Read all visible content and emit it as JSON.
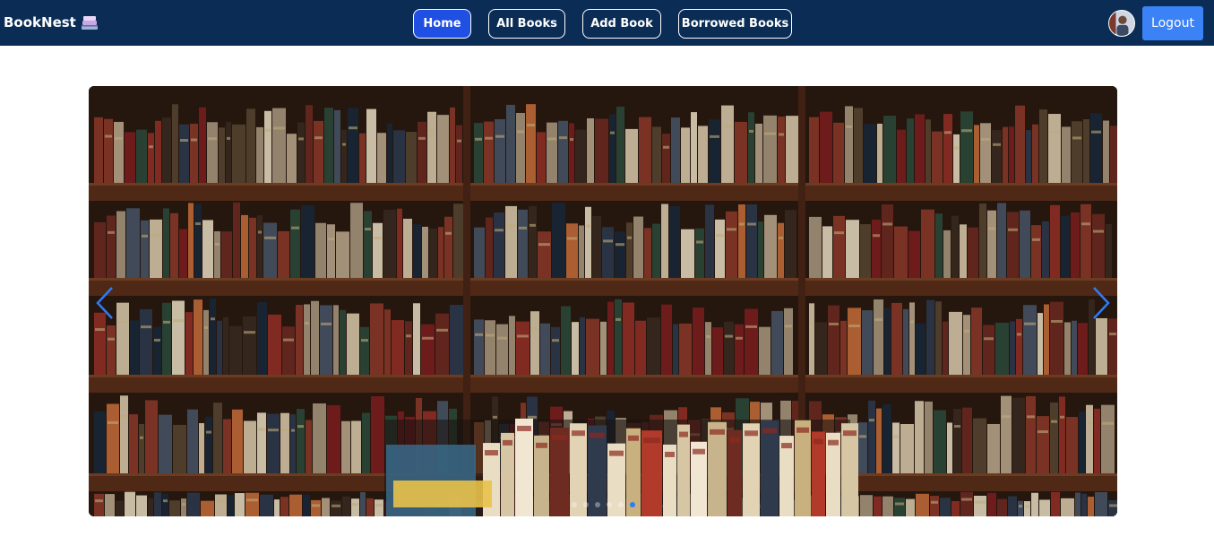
{
  "brand": {
    "name": "BookNest",
    "logo_icon": "book-stack-icon"
  },
  "nav": {
    "items": [
      {
        "label": "Home",
        "active": true
      },
      {
        "label": "All Books",
        "active": false
      },
      {
        "label": "Add Book",
        "active": false
      },
      {
        "label": "Borrowed Books",
        "active": false
      }
    ]
  },
  "user": {
    "avatar_icon": "user-avatar-icon",
    "logout_label": "Logout"
  },
  "carousel": {
    "prev_icon": "chevron-left-icon",
    "next_icon": "chevron-right-icon",
    "slide_count": 6,
    "active_index": 5
  },
  "colors": {
    "navbar": "#0b2d55",
    "active_nav": "#1f4fe3",
    "logout": "#3b82f6",
    "arrow": "#2f7cf6"
  }
}
